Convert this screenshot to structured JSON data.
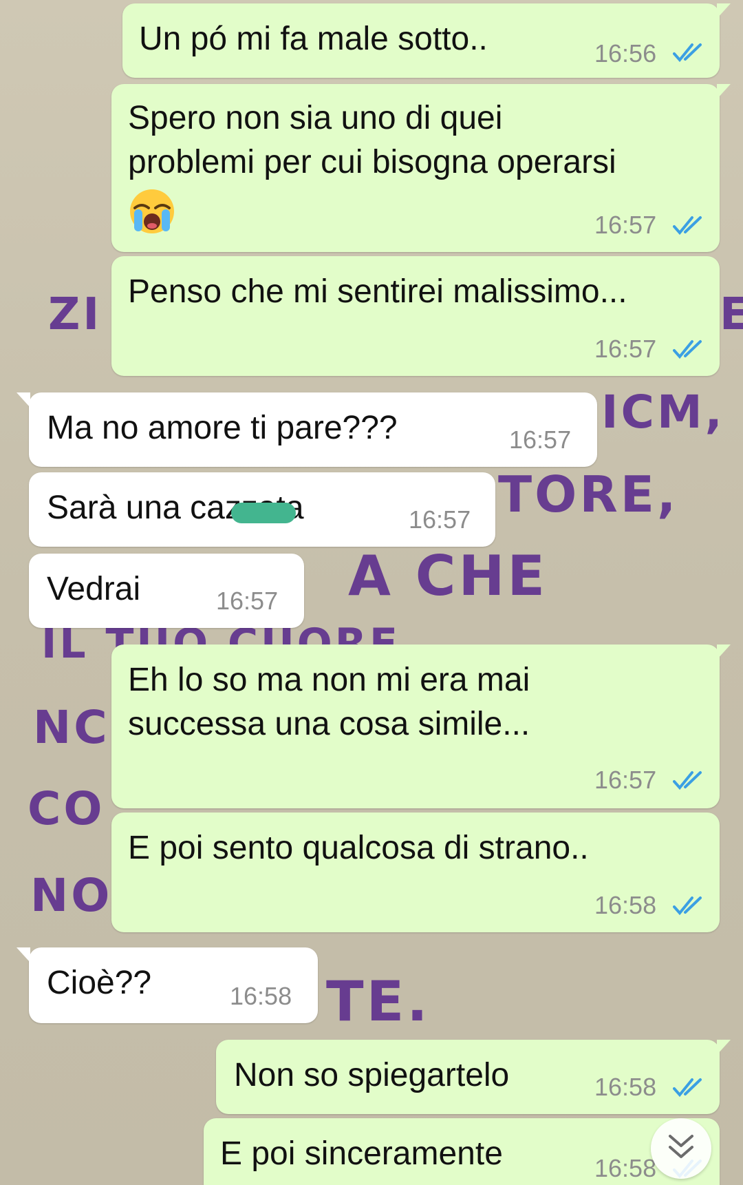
{
  "background": {
    "letters": [
      "ZI",
      "E",
      "ICM,",
      "TORE,",
      "A CHE",
      "IL TUO CUORE",
      "NC",
      "CO",
      "NO",
      "TE."
    ]
  },
  "colors": {
    "outgoing_bubble": "#e2fdc9",
    "incoming_bubble": "#ffffff",
    "read_ticks": "#3b9fe3",
    "scribble": "#43b58f"
  },
  "messages": [
    {
      "direction": "outgoing",
      "text": "Un pó mi fa male sotto..",
      "time": "16:56",
      "status": "read"
    },
    {
      "direction": "outgoing",
      "text": "Spero non sia uno di quei\nproblemi per cui bisogna operarsi",
      "emoji": "loudly-crying-face",
      "time": "16:57",
      "status": "read"
    },
    {
      "direction": "outgoing",
      "text": "Penso che mi sentirei malissimo...",
      "time": "16:57",
      "status": "read"
    },
    {
      "direction": "incoming",
      "text": "Ma no amore ti pare???",
      "time": "16:57"
    },
    {
      "direction": "incoming",
      "text": "Sarà una cazzata",
      "time": "16:57"
    },
    {
      "direction": "incoming",
      "text": "Vedrai",
      "time": "16:57"
    },
    {
      "direction": "outgoing",
      "text": "Eh lo so ma non mi era mai\nsuccessa una cosa simile...",
      "time": "16:57",
      "status": "read"
    },
    {
      "direction": "outgoing",
      "text": "E poi sento qualcosa di strano..",
      "time": "16:58",
      "status": "read"
    },
    {
      "direction": "incoming",
      "text": "Cioè??",
      "time": "16:58"
    },
    {
      "direction": "outgoing",
      "text": "Non so spiegartelo",
      "time": "16:58",
      "status": "read"
    },
    {
      "direction": "outgoing",
      "text": "E poi sinceramente",
      "time": "16:58",
      "status": "read"
    }
  ],
  "scroll_button": {
    "icon": "double-chevron-down-icon"
  }
}
